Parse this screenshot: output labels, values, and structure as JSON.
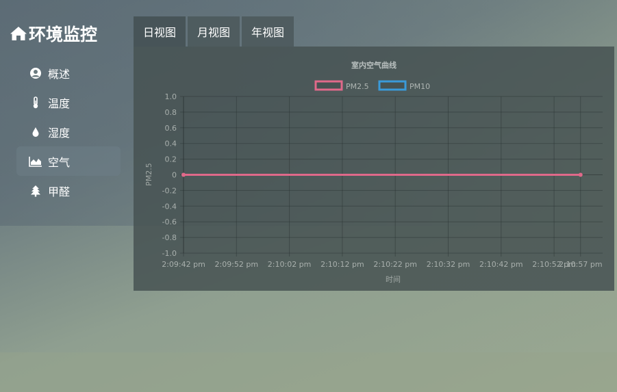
{
  "app": {
    "title": "环境监控"
  },
  "sidebar": {
    "items": [
      {
        "label": "概述",
        "icon": "user-circle-icon"
      },
      {
        "label": "温度",
        "icon": "thermometer-icon"
      },
      {
        "label": "湿度",
        "icon": "water-drop-icon"
      },
      {
        "label": "空气",
        "icon": "area-chart-icon",
        "active": true
      },
      {
        "label": "甲醛",
        "icon": "tree-icon"
      }
    ]
  },
  "tabs": [
    {
      "label": "日视图",
      "active": true
    },
    {
      "label": "月视图"
    },
    {
      "label": "年视图"
    }
  ],
  "colors": {
    "pm25": "#e0698a",
    "pm10": "#3a9ad9"
  },
  "chart_data": {
    "type": "line",
    "title": "室内空气曲线",
    "xlabel": "时间",
    "ylabel": "PM2.5",
    "ylim": [
      -1.0,
      1.0
    ],
    "yticks": [
      "1.0",
      "0.8",
      "0.6",
      "0.4",
      "0.2",
      "0",
      "-0.2",
      "-0.4",
      "-0.6",
      "-0.8",
      "-1.0"
    ],
    "xticks": [
      "2:09:42 pm",
      "2:09:52 pm",
      "2:10:02 pm",
      "2:10:12 pm",
      "2:10:22 pm",
      "2:10:32 pm",
      "2:10:42 pm",
      "2:10:52 pm",
      "2:10:57 pm"
    ],
    "legend_position": "top-center",
    "grid": true,
    "series": [
      {
        "name": "PM2.5",
        "x": [
          "2:09:42 pm",
          "2:10:57 pm"
        ],
        "values": [
          0,
          0
        ]
      },
      {
        "name": "PM10",
        "x": [],
        "values": []
      }
    ]
  }
}
